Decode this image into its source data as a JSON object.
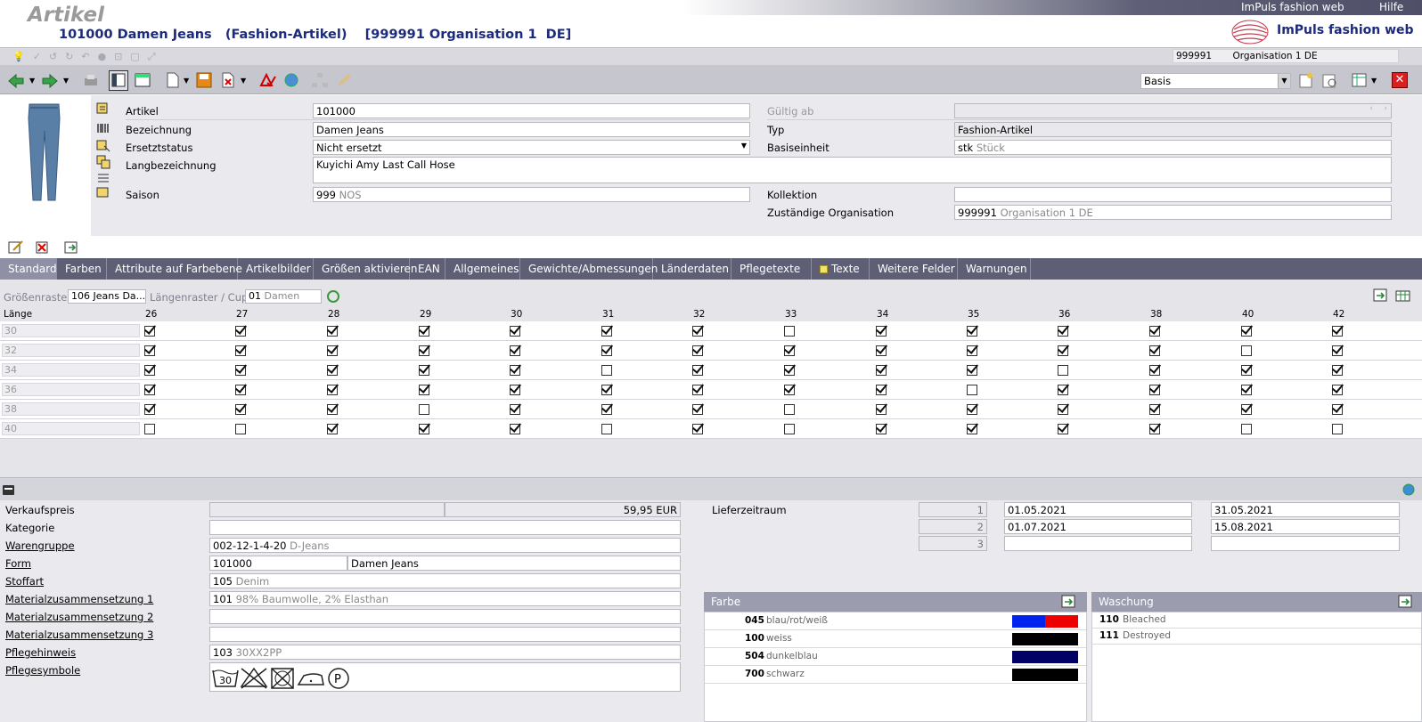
{
  "header": {
    "page_title": "Artikel",
    "subtitle": "101000 Damen Jeans   (Fashion-Artikel)    [999991 Organisation 1  DE]",
    "app_link": "ImPuls fashion web",
    "help_link": "Hilfe",
    "logo_text": "ImPuls fashion web",
    "org_code": "999991",
    "org_name": "Organisation 1  DE"
  },
  "toolbar": {
    "view_select": "Basis"
  },
  "form": {
    "artikel_label": "Artikel",
    "artikel_value": "101000",
    "bezeichnung_label": "Bezeichnung",
    "bezeichnung_value": "Damen Jeans",
    "ersetztstatus_label": "Ersetztstatus",
    "ersetztstatus_value": "Nicht ersetzt",
    "langbezeichnung_label": "Langbezeichnung",
    "langbezeichnung_value": "Kuyichi Amy Last Call Hose",
    "saison_label": "Saison",
    "saison_code": "999",
    "saison_name": "NOS",
    "gueltig_label": "Gültig ab",
    "typ_label": "Typ",
    "typ_value": "Fashion-Artikel",
    "basiseinheit_label": "Basiseinheit",
    "basiseinheit_code": "stk",
    "basiseinheit_name": "Stück",
    "kollektion_label": "Kollektion",
    "kollektion_value": "",
    "organisation_label": "Zuständige Organisation",
    "organisation_code": "999991",
    "organisation_name": "Organisation 1  DE"
  },
  "tabs": [
    "Standard",
    "Farben",
    "Attribute auf Farbebene",
    "Artikelbilder",
    "Größen aktivieren",
    "EAN",
    "Allgemeines",
    "Gewichte/Abmessungen",
    "Länderdaten",
    "Pflegetexte",
    "Texte",
    "Weitere Felder",
    "Warnungen"
  ],
  "sizes": {
    "groessenraster_label": "Größenraster",
    "groessenraster_value": "106 Jeans Da...",
    "laengenraster_label": "Längenraster / Cups",
    "laengenraster_code": "01",
    "laengenraster_name": "Damen",
    "laenge_header": "Länge",
    "columns": [
      "26",
      "27",
      "28",
      "29",
      "30",
      "31",
      "32",
      "33",
      "34",
      "35",
      "36",
      "38",
      "40",
      "42"
    ],
    "rows": [
      {
        "label": "30",
        "checks": [
          1,
          1,
          1,
          1,
          1,
          1,
          1,
          0,
          1,
          1,
          1,
          1,
          1,
          1
        ]
      },
      {
        "label": "32",
        "checks": [
          1,
          1,
          1,
          1,
          1,
          1,
          1,
          1,
          1,
          1,
          1,
          1,
          0,
          1
        ]
      },
      {
        "label": "34",
        "checks": [
          1,
          1,
          1,
          1,
          1,
          0,
          1,
          1,
          1,
          1,
          0,
          1,
          1,
          1
        ]
      },
      {
        "label": "36",
        "checks": [
          1,
          1,
          1,
          1,
          1,
          1,
          1,
          1,
          1,
          0,
          1,
          1,
          1,
          1
        ]
      },
      {
        "label": "38",
        "checks": [
          1,
          1,
          1,
          0,
          1,
          1,
          1,
          0,
          1,
          1,
          1,
          1,
          1,
          1
        ]
      },
      {
        "label": "40",
        "checks": [
          0,
          0,
          1,
          1,
          1,
          0,
          1,
          0,
          1,
          1,
          1,
          1,
          0,
          0
        ]
      }
    ]
  },
  "details": {
    "verkaufspreis_label": "Verkaufspreis",
    "verkaufspreis_value": "59,95 EUR",
    "kategorie_label": "Kategorie",
    "warengruppe_label": "Warengruppe",
    "warengruppe_code": "002-12-1-4-20",
    "warengruppe_name": "D-Jeans",
    "form_label": "Form",
    "form_code": "101000",
    "form_name": "Damen Jeans",
    "stoffart_label": "Stoffart",
    "stoffart_code": "105",
    "stoffart_name": "Denim",
    "mat1_label": "Materialzusammensetzung 1",
    "mat1_code": "101",
    "mat1_name": "98% Baumwolle, 2% Elasthan",
    "mat2_label": "Materialzusammensetzung 2",
    "mat3_label": "Materialzusammensetzung 3",
    "pflegehinweis_label": "Pflegehinweis",
    "pflegehinweis_code": "103",
    "pflegehinweis_name": "30XX2PP",
    "pflegesymbole_label": "Pflegesymbole",
    "wash_temp": "30",
    "lieferzeitraum_label": "Lieferzeitraum",
    "lieferzeitraum": [
      {
        "nr": "1",
        "from": "01.05.2021",
        "to": "31.05.2021"
      },
      {
        "nr": "2",
        "from": "01.07.2021",
        "to": "15.08.2021"
      },
      {
        "nr": "3",
        "from": "",
        "to": ""
      }
    ]
  },
  "farbe": {
    "title": "Farbe",
    "items": [
      {
        "code": "045",
        "name": "blau/rot/weiß",
        "colors": [
          "#0022ee",
          "#ee0000"
        ]
      },
      {
        "code": "100",
        "name": "weiss",
        "colors": [
          "#000000"
        ]
      },
      {
        "code": "504",
        "name": "dunkelblau",
        "colors": [
          "#000066"
        ]
      },
      {
        "code": "700",
        "name": "schwarz",
        "colors": [
          "#000000"
        ]
      }
    ]
  },
  "waschung": {
    "title": "Waschung",
    "items": [
      {
        "code": "110",
        "name": "Bleached"
      },
      {
        "code": "111",
        "name": "Destroyed"
      }
    ]
  }
}
